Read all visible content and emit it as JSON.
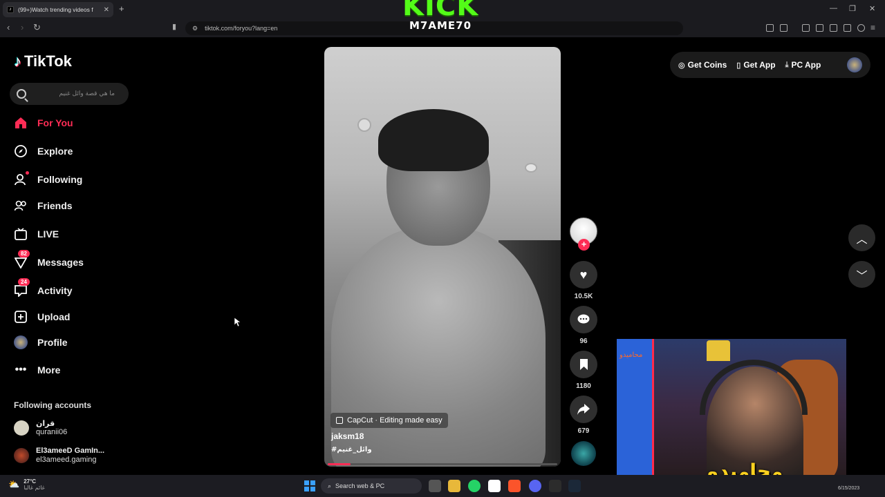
{
  "browser": {
    "tab_title": "(99+)Watch trending videos f",
    "url": "tiktok.com/foryou?lang=en"
  },
  "overlay": {
    "brand": "KICK",
    "streamer": "M7AME70"
  },
  "sidebar": {
    "logo_text": "TikTok",
    "search_placeholder": "ما هي قصة وائل غنيم",
    "items": [
      {
        "label": "For You",
        "icon": "home-icon",
        "active": true
      },
      {
        "label": "Explore",
        "icon": "compass-icon"
      },
      {
        "label": "Following",
        "icon": "user-follow-icon"
      },
      {
        "label": "Friends",
        "icon": "friends-icon"
      },
      {
        "label": "LIVE",
        "icon": "live-tv-icon"
      },
      {
        "label": "Messages",
        "icon": "paper-plane-icon",
        "badge": "82"
      },
      {
        "label": "Activity",
        "icon": "chat-bubble-icon",
        "badge": "24"
      },
      {
        "label": "Upload",
        "icon": "plus-square-icon"
      },
      {
        "label": "Profile",
        "icon": "avatar"
      },
      {
        "label": "More",
        "icon": "more-dots-icon"
      }
    ],
    "following_header": "Following accounts",
    "following": [
      {
        "name": "قران",
        "username": "quranii06"
      },
      {
        "name": "El3ameeD GamIn...",
        "username": "el3ameed.gaming"
      }
    ]
  },
  "video": {
    "capcut_label": "CapCut · Editing made easy",
    "author": "jaksm18",
    "hashtag": "#وائل_غنيم",
    "progress_fraction": 0.1
  },
  "actions": {
    "likes": "10.5K",
    "comments": "96",
    "saves": "1180",
    "shares": "679"
  },
  "header": {
    "get_coins": "Get Coins",
    "get_app": "Get App",
    "pc_app": "PC App"
  },
  "webcam": {
    "logo_text": "محاميدو",
    "sign_text": "محاميدو"
  },
  "taskbar": {
    "temperature": "27°C",
    "weather_text": "غائم غالبا",
    "search_label": "Search web & PC",
    "date": "6/15/2023"
  },
  "colors": {
    "accent": "#fe2c55",
    "kick_green": "#53fc18"
  }
}
